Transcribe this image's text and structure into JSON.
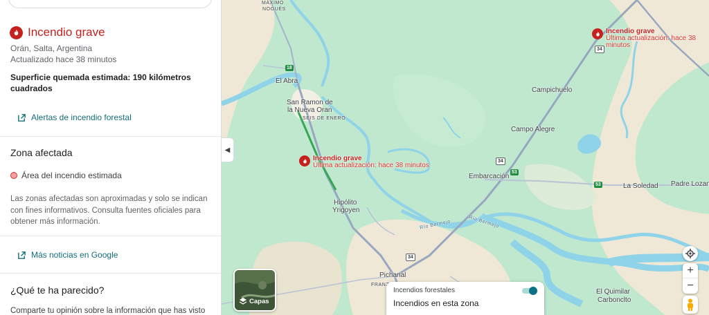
{
  "panel": {
    "title": "Incendio grave",
    "location": "Orán, Salta, Argentina",
    "updated": "Actualizado hace 38 minutos",
    "area_estimate": "Superficie quemada estimada: 190 kilómetros cuadrados",
    "alerts_link": "Alertas de incendio forestal",
    "zone_title": "Zona afectada",
    "legend_label": "Área del incendio estimada",
    "disclaimer": "Las zonas afectadas son aproximadas y solo se indican con fines informativos. Consulta fuentes oficiales para obtener más información.",
    "news_link": "Más noticias en Google",
    "feedback_title": "¿Qué te ha parecido?",
    "feedback_text": "Comparte tu opinión sobre la información que has visto"
  },
  "map": {
    "places": {
      "maximo_nogues_1": "MÁXIMO",
      "maximo_nogues_2": "NOGUÉS",
      "el_abra": "El Abra",
      "san_ramon_1": "San Ramon de",
      "san_ramon_2": "la Nueva Oran",
      "seis_de_enero": "SEIS DE ENERO",
      "hipolito_1": "Hipólito",
      "hipolito_2": "Yrigoyen",
      "campichuelo": "Campichuelo",
      "campo_alegre": "Campo Alegre",
      "embarcacion": "Embarcación",
      "la_soledad": "La Soledad",
      "padre_lozano": "Padre Lozano",
      "pichanal": "Pichanal",
      "franz": "FRANZ",
      "el_quimilar_1": "El Quimilar",
      "el_quimilar_2": "Carbonclto",
      "rio_bermejo_1": "Río Bermejo",
      "rio_bermejo_2": "Río Bermejo"
    },
    "routes": {
      "r18": "18",
      "r34_top": "34",
      "r34_mid": "34",
      "r34_bottom": "34",
      "r53_a": "53",
      "r53_b": "53"
    },
    "fire_center": {
      "title": "Incendio grave",
      "subtitle": "Última actualización: hace 38 minutos"
    },
    "fire_top": {
      "title": "Incendio grave",
      "subtitle": "Última actualización: hace 38 minutos"
    },
    "layers_label": "Capas",
    "card": {
      "line1": "Incendios forestales",
      "line2": "Incendios en esta zona",
      "toggle_on": true
    },
    "colors": {
      "fire_red": "#c5221f",
      "water": "#8fd3e8",
      "park_green": "#bfe8cf"
    }
  }
}
